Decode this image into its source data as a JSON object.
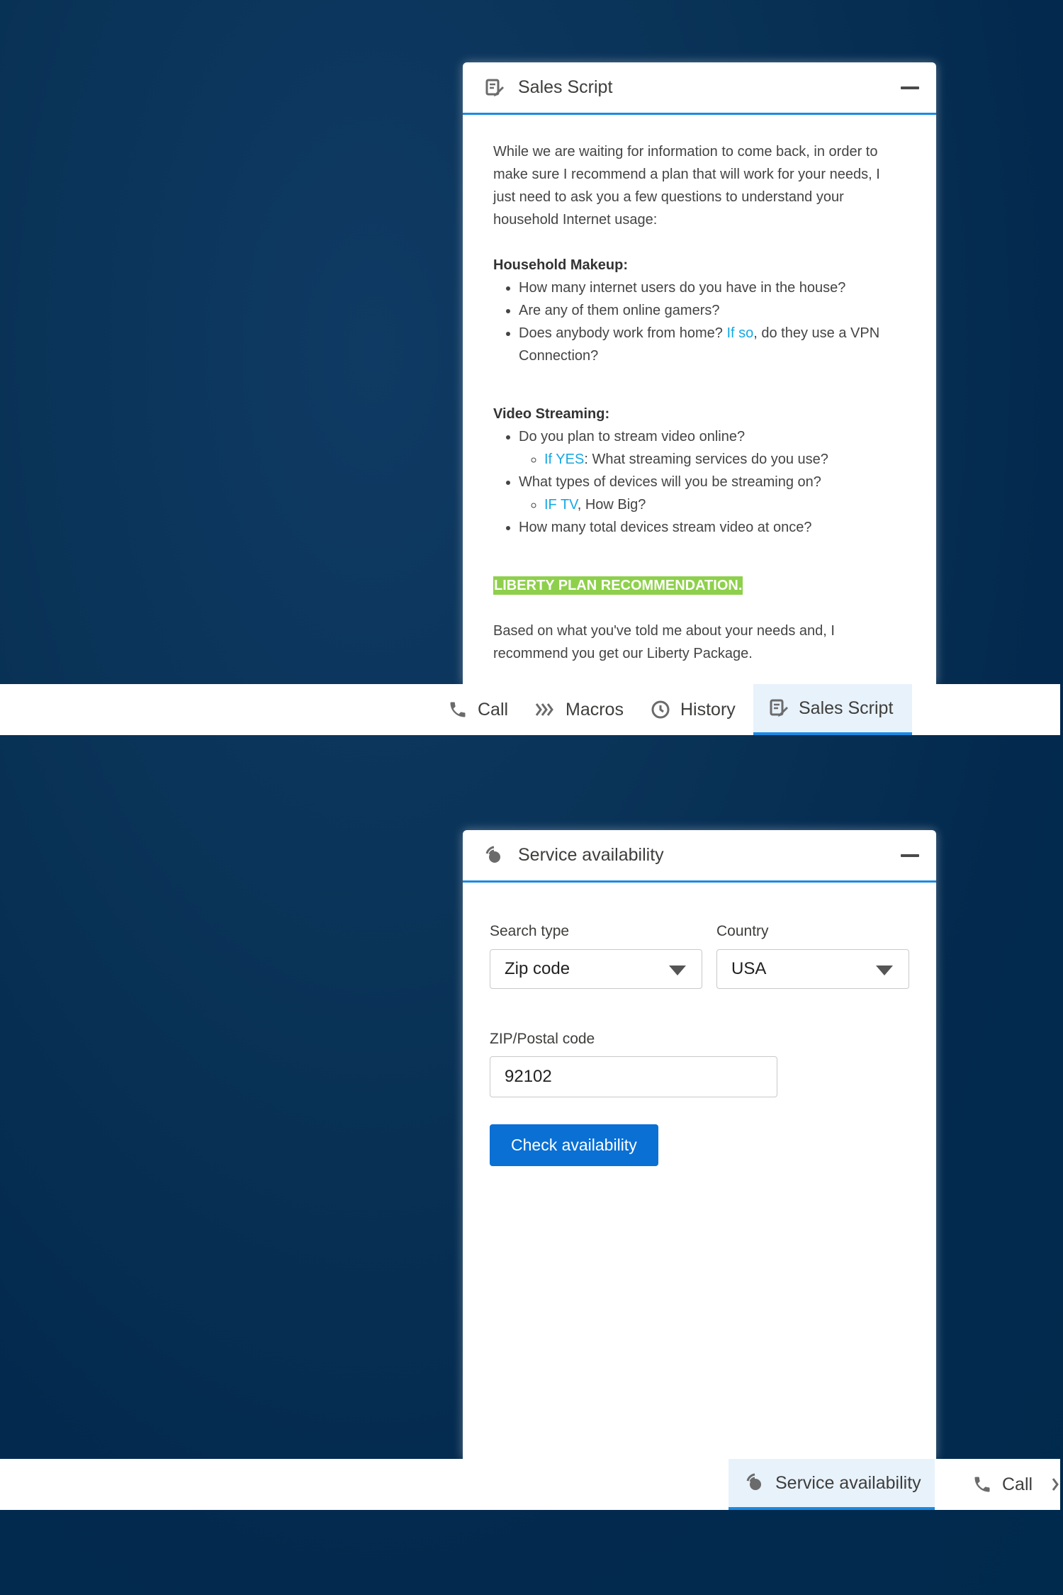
{
  "sales_script": {
    "title": "Sales Script",
    "intro": "While we are waiting for information to come back, in order to make sure I recommend a plan that will work for your needs, I just need to ask you a few questions to understand your household Internet usage:",
    "household": {
      "heading": "Household Makeup:",
      "q1": "How many internet users do you have in the house?",
      "q2": "Are any of them online gamers?",
      "q3_pre": "Does anybody work from home? ",
      "q3_link": "If so",
      "q3_post": ", do they use a VPN Connection?"
    },
    "video": {
      "heading": "Video Streaming:",
      "q1": "Do you plan to stream video online?",
      "q1_sub_link": "If YES",
      "q1_sub_text": ": What streaming services do you use?",
      "q2": "What types of devices will you be streaming on?",
      "q2_sub_link": "IF TV",
      "q2_sub_text": ", How Big?",
      "q3": "How many total devices stream video at once?"
    },
    "recommendation": "LIBERTY PLAN RECOMMENDATION.",
    "closing": "Based on what you've told me about your needs and, I recommend you get our Liberty Package."
  },
  "utility_bar_top": {
    "call": "Call",
    "macros": "Macros",
    "history": "History",
    "sales_script": "Sales Script"
  },
  "service_availability": {
    "title": "Service availability",
    "search_type_label": "Search type",
    "search_type_value": "Zip code",
    "country_label": "Country",
    "country_value": "USA",
    "zip_label": "ZIP/Postal code",
    "zip_value": "92102",
    "check_button": "Check availability"
  },
  "utility_bar_bottom": {
    "service_availability": "Service availability",
    "call": "Call"
  },
  "colors": {
    "accent": "#1b8ae3",
    "primary_button": "#0a70d4",
    "link": "#16a8e3",
    "highlight": "#8ed04b",
    "background": "#002a4d"
  }
}
